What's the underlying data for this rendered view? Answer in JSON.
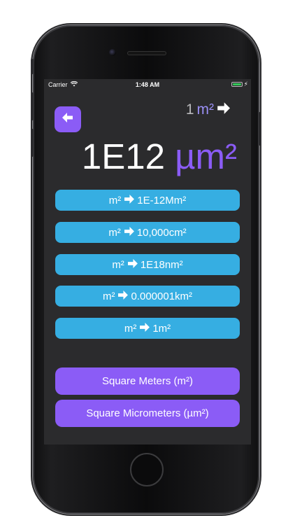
{
  "status_bar": {
    "carrier": "Carrier",
    "time": "1:48 AM"
  },
  "header": {
    "from_value": "1",
    "from_unit": "m²"
  },
  "result": {
    "value": "1E12",
    "unit": "µm²"
  },
  "conversions": [
    {
      "from": "m²",
      "to": "1E-12Mm²"
    },
    {
      "from": "m²",
      "to": "10,000cm²"
    },
    {
      "from": "m²",
      "to": "1E18nm²"
    },
    {
      "from": "m²",
      "to": "0.000001km²"
    },
    {
      "from": "m²",
      "to": "1m²"
    }
  ],
  "unit_buttons": {
    "from_label": "Square Meters (m²)",
    "to_label": "Square Micrometers (µm²)"
  },
  "colors": {
    "accent_purple": "#8b5cf6",
    "accent_blue": "#36aee2",
    "screen_bg": "#2b2b2d",
    "text_white": "#ffffff"
  },
  "icons": {
    "back": "arrow-left-icon",
    "arrow": "arrow-right-icon",
    "wifi": "wifi-icon",
    "battery": "battery-icon"
  }
}
